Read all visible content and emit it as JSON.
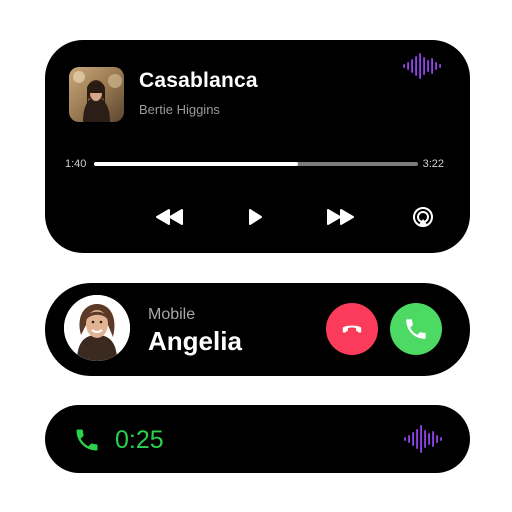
{
  "music_player": {
    "title": "Casablanca",
    "artist": "Bertie Higgins",
    "elapsed": "1:40",
    "total": "3:22",
    "progress_fraction": 0.63,
    "controls": [
      "rewind-icon",
      "play-icon",
      "fast-forward-icon",
      "airplay-icon"
    ],
    "waveform_color": "#7b3fe4"
  },
  "incoming_call": {
    "caller_type": "Mobile",
    "caller_name": "Angelia",
    "decline_color": "#fb3b5a",
    "accept_color": "#4cd964"
  },
  "active_call": {
    "timer": "0:25",
    "accent_color": "#2bd14c",
    "waveform_color": "#7b3fe4"
  }
}
